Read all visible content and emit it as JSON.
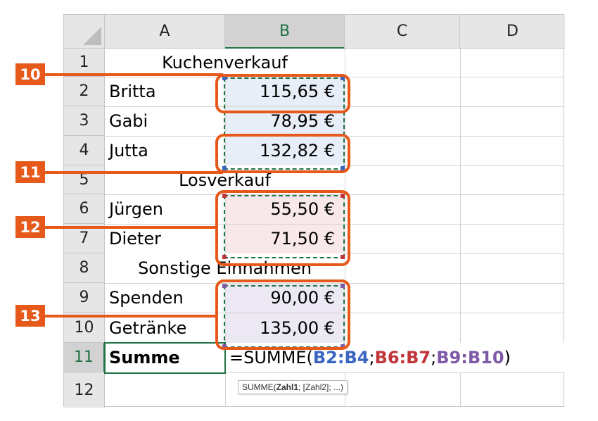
{
  "columns": [
    "A",
    "B",
    "C",
    "D"
  ],
  "rows": [
    "1",
    "2",
    "3",
    "4",
    "5",
    "6",
    "7",
    "8",
    "9",
    "10",
    "11",
    "12"
  ],
  "cells": {
    "r1": "Kuchenverkauf",
    "r2": {
      "a": "Britta",
      "b": "115,65 €"
    },
    "r3": {
      "a": "Gabi",
      "b": "78,95 €"
    },
    "r4": {
      "a": "Jutta",
      "b": "132,82 €"
    },
    "r5": "Losverkauf",
    "r6": {
      "a": "Jürgen",
      "b": "55,50 €"
    },
    "r7": {
      "a": "Dieter",
      "b": "71,50 €"
    },
    "r8": "Sonstige Einnahmen",
    "r9": {
      "a": "Spenden",
      "b": "90,00 €"
    },
    "r10": {
      "a": "Getränke",
      "b": "135,00 €"
    },
    "r11": {
      "a": "Summe"
    }
  },
  "formula": {
    "prefix": "=SUMME(",
    "ref1": "B2:B4",
    "sep1": ";",
    "ref2": "B6:B7",
    "sep2": ";",
    "ref3": "B9:B10",
    "suffix": ")"
  },
  "tooltip": {
    "fn": "SUMME(",
    "arg1": "Zahl1",
    "rest": "; [Zahl2]; ...)"
  },
  "callouts": [
    "10",
    "11",
    "12",
    "13"
  ],
  "colors": {
    "callout": "#e6591a",
    "ref1": "#3a66c1",
    "ref2": "#c0353a",
    "ref3": "#7e5aa6",
    "fill1": "#e8eef8",
    "fill2": "#f8e8ea",
    "fill3": "#ece8f4",
    "active_border": "#217346"
  }
}
